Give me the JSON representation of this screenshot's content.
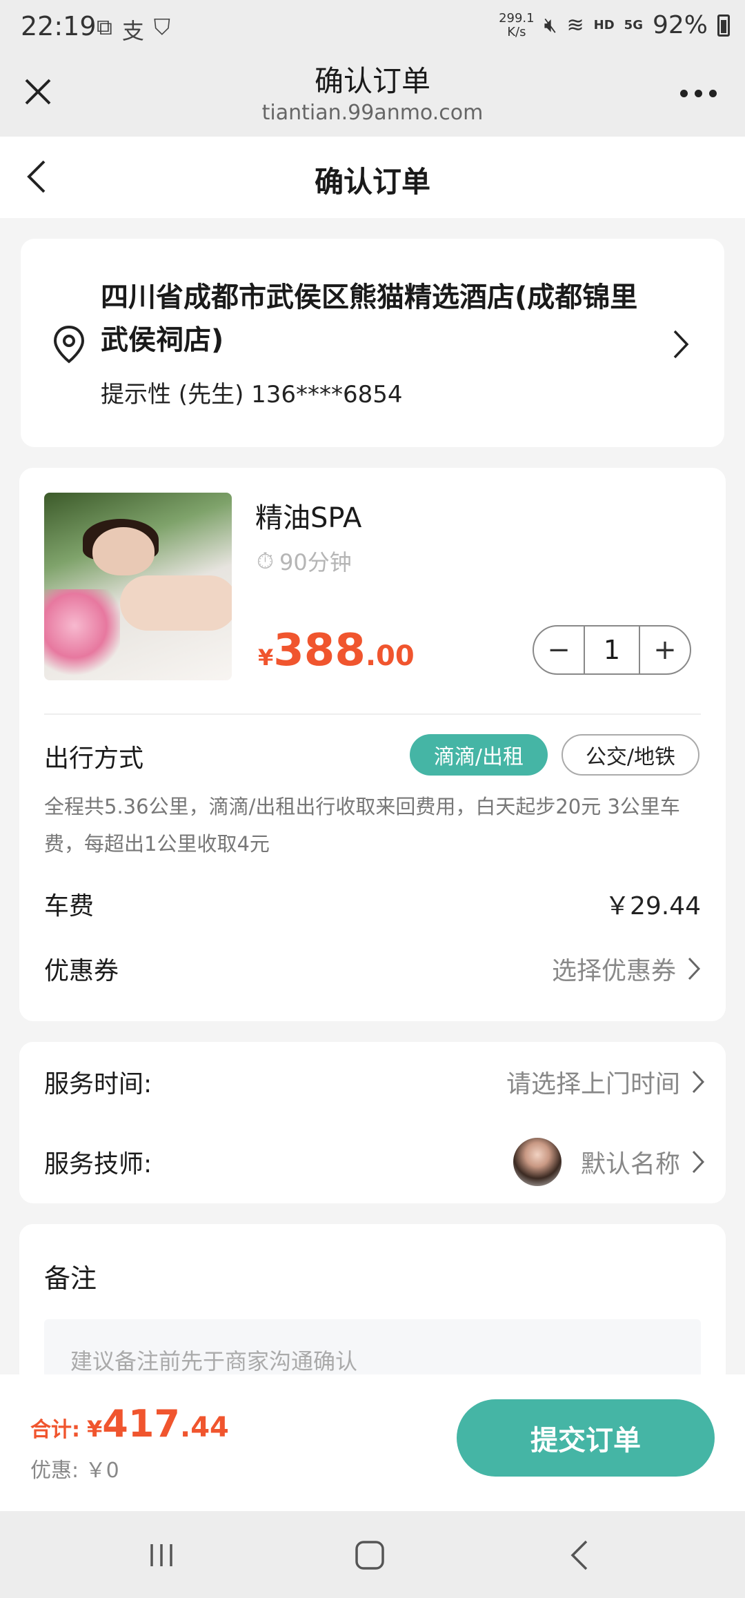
{
  "status_bar": {
    "time": "22:19",
    "left_icons": [
      "screen-capture-icon",
      "alipay-icon",
      "shield-icon"
    ],
    "net_speed": "299.1",
    "net_unit": "K/s",
    "hd": "HD",
    "signal": "5G",
    "battery": "92%"
  },
  "browser": {
    "title": "确认订单",
    "url": "tiantian.99anmo.com"
  },
  "page": {
    "title": "确认订单"
  },
  "address": {
    "text": "四川省成都市武侯区熊猫精选酒店(成都锦里武侯祠店)",
    "contact": "提示性 (先生) 136****6854"
  },
  "product": {
    "name": "精油SPA",
    "duration": "90分钟",
    "price_currency": "¥",
    "price_int": "388",
    "price_dec": ".00",
    "quantity": "1"
  },
  "travel": {
    "label": "出行方式",
    "option_active": "滴滴/出租",
    "option_inactive": "公交/地铁",
    "description": "全程共5.36公里，滴滴/出租出行收取来回费用，白天起步20元 3公里车费，每超出1公里收取4元"
  },
  "fees": {
    "car_label": "车费",
    "car_value": "￥29.44",
    "coupon_label": "优惠券",
    "coupon_value": "选择优惠券"
  },
  "service": {
    "time_label": "服务时间:",
    "time_value": "请选择上门时间",
    "tech_label": "服务技师:",
    "tech_value": "默认名称"
  },
  "remark": {
    "title": "备注",
    "placeholder": "建议备注前先于商家沟通确认"
  },
  "bottom": {
    "total_label": "合计:",
    "total_currency": "¥",
    "total_int": "417",
    "total_dec": ".44",
    "discount": "优惠: ￥0",
    "submit": "提交订单"
  },
  "colors": {
    "accent": "#45b5a5",
    "price": "#f0552e"
  }
}
